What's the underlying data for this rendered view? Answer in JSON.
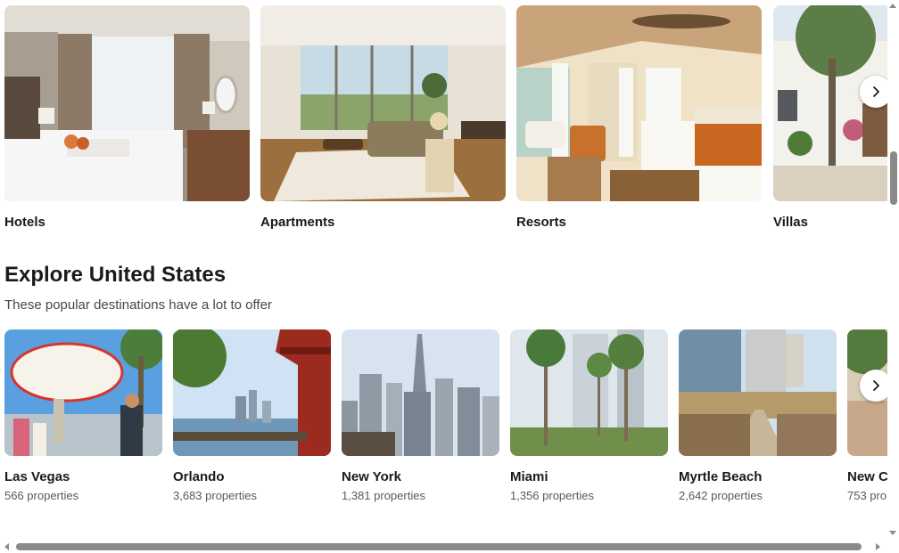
{
  "property_types": {
    "items": [
      {
        "label": "Hotels",
        "image": "hotel-room-photo"
      },
      {
        "label": "Apartments",
        "image": "apartment-living-room-photo"
      },
      {
        "label": "Resorts",
        "image": "resort-bedroom-photo"
      },
      {
        "label": "Villas",
        "image": "villa-courtyard-photo"
      }
    ],
    "next_icon": "chevron-right-icon"
  },
  "explore": {
    "title": "Explore United States",
    "subtitle": "These popular destinations have a lot to offer",
    "destinations": [
      {
        "name": "Las Vegas",
        "count": "566 properties",
        "image": "las-vegas-sign-photo"
      },
      {
        "name": "Orlando",
        "count": "3,683 properties",
        "image": "orlando-lake-photo"
      },
      {
        "name": "New York",
        "count": "1,381 properties",
        "image": "new-york-skyline-photo"
      },
      {
        "name": "Miami",
        "count": "1,356 properties",
        "image": "miami-palm-walk-photo"
      },
      {
        "name": "Myrtle Beach",
        "count": "2,642 properties",
        "image": "myrtle-beach-boardwalk-photo"
      },
      {
        "name": "New C",
        "count": "753 pro",
        "image": "partial-destination-photo"
      }
    ],
    "next_icon": "chevron-right-icon"
  },
  "colors": {
    "text_primary": "#1a1a1a",
    "text_secondary": "#595959",
    "scrollbar_thumb": "#8a8a8a"
  }
}
